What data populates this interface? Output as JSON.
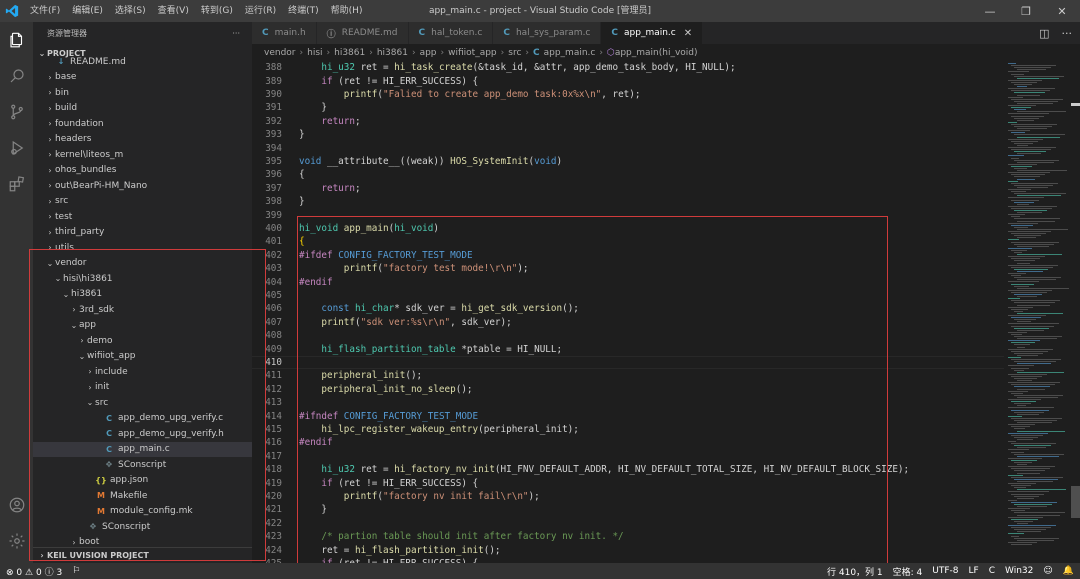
{
  "window": {
    "title": "app_main.c - project - Visual Studio Code [管理员]",
    "menu": [
      "文件(F)",
      "编辑(E)",
      "选择(S)",
      "查看(V)",
      "转到(G)",
      "运行(R)",
      "终端(T)",
      "帮助(H)"
    ],
    "controls": [
      "—",
      "❐",
      "✕"
    ]
  },
  "sidebar": {
    "header": "资源管理器",
    "more": "···",
    "section": "PROJECT",
    "footer_section": "KEIL UVISION PROJECT",
    "tree": [
      {
        "label": "README.md",
        "depth": 1,
        "kind": "md"
      },
      {
        "label": "base",
        "depth": 1,
        "kind": "folder",
        "open": false
      },
      {
        "label": "bin",
        "depth": 1,
        "kind": "folder",
        "open": false
      },
      {
        "label": "build",
        "depth": 1,
        "kind": "folder",
        "open": false
      },
      {
        "label": "foundation",
        "depth": 1,
        "kind": "folder",
        "open": false
      },
      {
        "label": "headers",
        "depth": 1,
        "kind": "folder",
        "open": false
      },
      {
        "label": "kernel\\liteos_m",
        "depth": 1,
        "kind": "folder",
        "open": false
      },
      {
        "label": "ohos_bundles",
        "depth": 1,
        "kind": "folder",
        "open": false
      },
      {
        "label": "out\\BearPi-HM_Nano",
        "depth": 1,
        "kind": "folder",
        "open": false
      },
      {
        "label": "src",
        "depth": 1,
        "kind": "folder",
        "open": false
      },
      {
        "label": "test",
        "depth": 1,
        "kind": "folder",
        "open": false
      },
      {
        "label": "third_party",
        "depth": 1,
        "kind": "folder",
        "open": false
      },
      {
        "label": "utils",
        "depth": 1,
        "kind": "folder",
        "open": false
      },
      {
        "label": "vendor",
        "depth": 1,
        "kind": "folder",
        "open": true
      },
      {
        "label": "hisi\\hi3861",
        "depth": 2,
        "kind": "folder",
        "open": true
      },
      {
        "label": "hi3861",
        "depth": 3,
        "kind": "folder",
        "open": true
      },
      {
        "label": "3rd_sdk",
        "depth": 4,
        "kind": "folder",
        "open": false
      },
      {
        "label": "app",
        "depth": 4,
        "kind": "folder",
        "open": true
      },
      {
        "label": "demo",
        "depth": 5,
        "kind": "folder",
        "open": false
      },
      {
        "label": "wifiiot_app",
        "depth": 5,
        "kind": "folder",
        "open": true
      },
      {
        "label": "include",
        "depth": 6,
        "kind": "folder",
        "open": false
      },
      {
        "label": "init",
        "depth": 6,
        "kind": "folder",
        "open": false
      },
      {
        "label": "src",
        "depth": 6,
        "kind": "folder",
        "open": true
      },
      {
        "label": "app_demo_upg_verify.c",
        "depth": 7,
        "kind": "c"
      },
      {
        "label": "app_demo_upg_verify.h",
        "depth": 7,
        "kind": "c"
      },
      {
        "label": "app_main.c",
        "depth": 7,
        "kind": "c",
        "selected": true
      },
      {
        "label": "SConscript",
        "depth": 7,
        "kind": "sc"
      },
      {
        "label": "app.json",
        "depth": 6,
        "kind": "json"
      },
      {
        "label": "Makefile",
        "depth": 6,
        "kind": "mk"
      },
      {
        "label": "module_config.mk",
        "depth": 6,
        "kind": "mk"
      },
      {
        "label": "SConscript",
        "depth": 5,
        "kind": "sc"
      },
      {
        "label": "boot",
        "depth": 4,
        "kind": "folder",
        "open": false
      }
    ]
  },
  "tabs": [
    {
      "label": "main.h",
      "icon": "C",
      "active": false
    },
    {
      "label": "README.md",
      "icon": "ⓘ",
      "active": false
    },
    {
      "label": "hal_token.c",
      "icon": "C",
      "active": false
    },
    {
      "label": "hal_sys_param.c",
      "icon": "C",
      "active": false
    },
    {
      "label": "app_main.c",
      "icon": "C",
      "active": true
    }
  ],
  "tab_close": "✕",
  "breadcrumb": [
    "vendor",
    "hisi",
    "hi3861",
    "hi3861",
    "app",
    "wifiiot_app",
    "src",
    "app_main.c",
    "app_main(hi_void)"
  ],
  "editor": {
    "first_line": 388,
    "current_line": 410,
    "lines": [
      [
        [
          "    ",
          ""
        ],
        [
          "hi_u32",
          "ty"
        ],
        [
          " ret = ",
          ""
        ],
        [
          "hi_task_create",
          "fn"
        ],
        [
          "(&task_id, &attr, app_demo_task_body, HI_NULL);",
          ""
        ]
      ],
      [
        [
          "    ",
          ""
        ],
        [
          "if",
          "ctl"
        ],
        [
          " (ret != HI_ERR_SUCCESS) {",
          ""
        ]
      ],
      [
        [
          "        ",
          ""
        ],
        [
          "printf",
          "fn"
        ],
        [
          "(",
          ""
        ],
        [
          "\"Falied to create app_demo task:0x%x\\n\"",
          "str"
        ],
        [
          ", ret);",
          ""
        ]
      ],
      [
        [
          "    }",
          ""
        ]
      ],
      [
        [
          "    ",
          ""
        ],
        [
          "return",
          "ctl"
        ],
        [
          ";",
          ""
        ]
      ],
      [
        [
          "}",
          ""
        ]
      ],
      [
        [
          "",
          ""
        ]
      ],
      [
        [
          "void",
          "kw"
        ],
        [
          " __attribute__((weak)) ",
          ""
        ],
        [
          "HOS_SystemInit",
          "fn"
        ],
        [
          "(",
          ""
        ],
        [
          "void",
          "kw"
        ],
        [
          ")",
          ""
        ]
      ],
      [
        [
          "{",
          ""
        ]
      ],
      [
        [
          "    ",
          ""
        ],
        [
          "return",
          "ctl"
        ],
        [
          ";",
          ""
        ]
      ],
      [
        [
          "}",
          ""
        ]
      ],
      [
        [
          "",
          ""
        ]
      ],
      [
        [
          "hi_void",
          "ty"
        ],
        [
          " ",
          ""
        ],
        [
          "app_main",
          "fn"
        ],
        [
          "(",
          ""
        ],
        [
          "hi_void",
          "ty"
        ],
        [
          ")",
          ""
        ]
      ],
      [
        [
          "{",
          "br"
        ]
      ],
      [
        [
          "#ifdef",
          "ctl"
        ],
        [
          " ",
          ""
        ],
        [
          "CONFIG_FACTORY_TEST_MODE",
          "mac"
        ]
      ],
      [
        [
          "        ",
          ""
        ],
        [
          "printf",
          "fn"
        ],
        [
          "(",
          ""
        ],
        [
          "\"factory test mode!\\r\\n\"",
          "str"
        ],
        [
          ");",
          ""
        ]
      ],
      [
        [
          "#endif",
          "ctl"
        ]
      ],
      [
        [
          "",
          ""
        ]
      ],
      [
        [
          "    ",
          ""
        ],
        [
          "const",
          "kw"
        ],
        [
          " ",
          ""
        ],
        [
          "hi_char",
          "ty"
        ],
        [
          "* sdk_ver = ",
          ""
        ],
        [
          "hi_get_sdk_version",
          "fn"
        ],
        [
          "();",
          ""
        ]
      ],
      [
        [
          "    ",
          ""
        ],
        [
          "printf",
          "fn"
        ],
        [
          "(",
          ""
        ],
        [
          "\"sdk ver:%s\\r\\n\"",
          "str"
        ],
        [
          ", sdk_ver);",
          ""
        ]
      ],
      [
        [
          "",
          ""
        ]
      ],
      [
        [
          "    ",
          ""
        ],
        [
          "hi_flash_partition_table",
          "ty"
        ],
        [
          " *ptable = HI_NULL;",
          ""
        ]
      ],
      [
        [
          "",
          ""
        ]
      ],
      [
        [
          "    ",
          ""
        ],
        [
          "peripheral_init",
          "fn"
        ],
        [
          "();",
          ""
        ]
      ],
      [
        [
          "    ",
          ""
        ],
        [
          "peripheral_init_no_sleep",
          "fn"
        ],
        [
          "();",
          ""
        ]
      ],
      [
        [
          "",
          ""
        ]
      ],
      [
        [
          "#ifndef",
          "ctl"
        ],
        [
          " ",
          ""
        ],
        [
          "CONFIG_FACTORY_TEST_MODE",
          "mac"
        ]
      ],
      [
        [
          "    ",
          ""
        ],
        [
          "hi_lpc_register_wakeup_entry",
          "fn"
        ],
        [
          "(peripheral_init);",
          ""
        ]
      ],
      [
        [
          "#endif",
          "ctl"
        ]
      ],
      [
        [
          "",
          ""
        ]
      ],
      [
        [
          "    ",
          ""
        ],
        [
          "hi_u32",
          "ty"
        ],
        [
          " ret = ",
          ""
        ],
        [
          "hi_factory_nv_init",
          "fn"
        ],
        [
          "(HI_FNV_DEFAULT_ADDR, HI_NV_DEFAULT_TOTAL_SIZE, HI_NV_DEFAULT_BLOCK_SIZE);",
          ""
        ]
      ],
      [
        [
          "    ",
          ""
        ],
        [
          "if",
          "ctl"
        ],
        [
          " (ret != HI_ERR_SUCCESS) {",
          ""
        ]
      ],
      [
        [
          "        ",
          ""
        ],
        [
          "printf",
          "fn"
        ],
        [
          "(",
          ""
        ],
        [
          "\"factory nv init fail\\r\\n\"",
          "str"
        ],
        [
          ");",
          ""
        ]
      ],
      [
        [
          "    }",
          ""
        ]
      ],
      [
        [
          "",
          ""
        ]
      ],
      [
        [
          "    ",
          ""
        ],
        [
          "/* partion table should init after factory nv init. */",
          "cmt"
        ]
      ],
      [
        [
          "    ret = ",
          ""
        ],
        [
          "hi_flash_partition_init",
          "fn"
        ],
        [
          "();",
          ""
        ]
      ],
      [
        [
          "    ",
          ""
        ],
        [
          "if",
          "ctl"
        ],
        [
          " (ret != HI_ERR_SUCCESS) {",
          ""
        ]
      ]
    ]
  },
  "statusbar": {
    "errors": "0",
    "warnings": "0",
    "info": "3",
    "position": "行 410，列 1",
    "spaces": "空格: 4",
    "encoding": "UTF-8",
    "eol": "LF",
    "language": "C",
    "platform": "Win32"
  },
  "icons": {
    "activity": [
      "explorer-icon",
      "search-icon",
      "source-control-icon",
      "run-debug-icon",
      "extensions-icon",
      "account-icon",
      "settings-gear-icon"
    ]
  },
  "colors": {
    "annotation": "#d03b3b",
    "accent": "#007acc"
  }
}
